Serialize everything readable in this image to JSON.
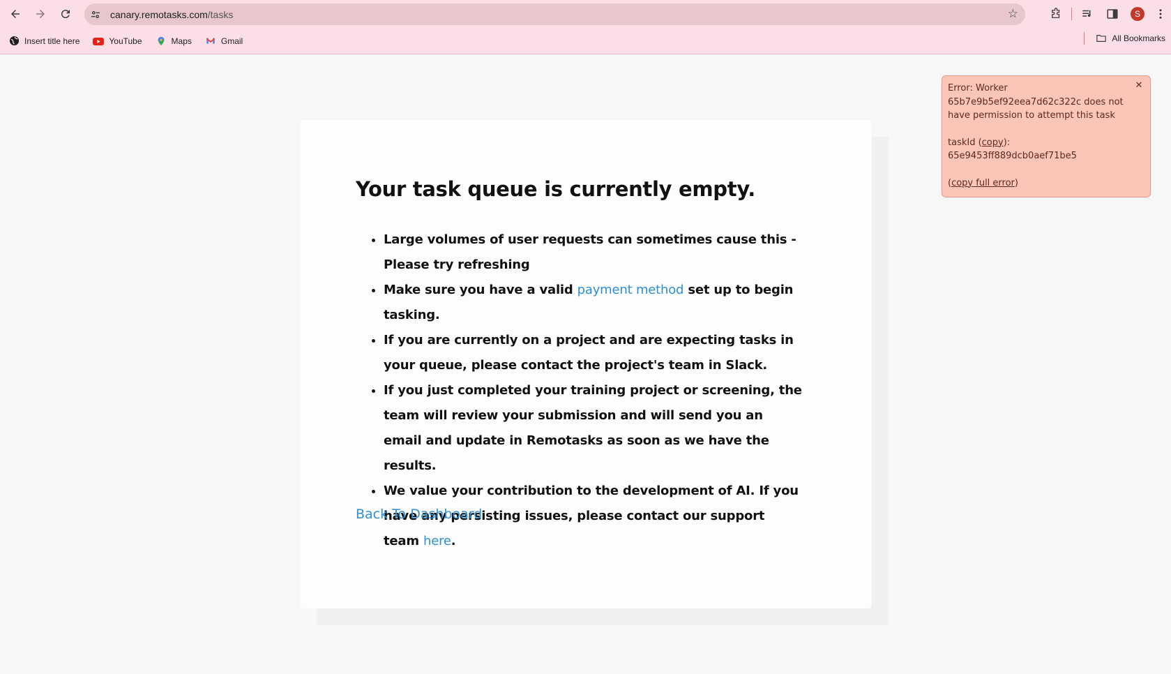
{
  "browser": {
    "url_host": "canary.remotasks.com",
    "url_path": "/tasks",
    "profile_initial": "S",
    "bookmarks": [
      {
        "label": "Insert title here",
        "icon": "globe-icon"
      },
      {
        "label": "YouTube",
        "icon": "youtube-icon"
      },
      {
        "label": "Maps",
        "icon": "maps-icon"
      },
      {
        "label": "Gmail",
        "icon": "gmail-icon"
      }
    ],
    "all_bookmarks": "All Bookmarks"
  },
  "page": {
    "heading": "Your task queue is currently empty.",
    "items": {
      "i1": "Large volumes of user requests can sometimes cause this - Please try refreshing",
      "i2_pre": "Make sure you have a valid ",
      "i2_link": "payment method",
      "i2_post": " set up to begin tasking.",
      "i3": "If you are currently on a project and are expecting tasks in your queue, please contact the project's team in Slack.",
      "i4": "If you just completed your training project or screening, the team will review your submission and will send you an email and update in Remotasks as soon as we have the results.",
      "i5_pre": "We value your contribution to the development of AI. If you have any persisting issues, please contact our support team ",
      "i5_link": "here",
      "i5_post": "."
    },
    "back_link": "Back To Dashboard"
  },
  "toast": {
    "error_text": "Error: Worker 65b7e9b5ef92eea7d62c322c does not have permission to attempt this task",
    "taskid_label": "taskId (",
    "copy_label": "copy",
    "taskid_suffix": "):",
    "task_id": "65e9453ff889dcb0aef71be5",
    "copy_full_open": "(",
    "copy_full_label": "copy full error",
    "copy_full_close": ")"
  },
  "colors": {
    "chrome_bg": "#fcdee6",
    "link": "#2d8fd5",
    "toast_bg": "#fbc5b8"
  }
}
